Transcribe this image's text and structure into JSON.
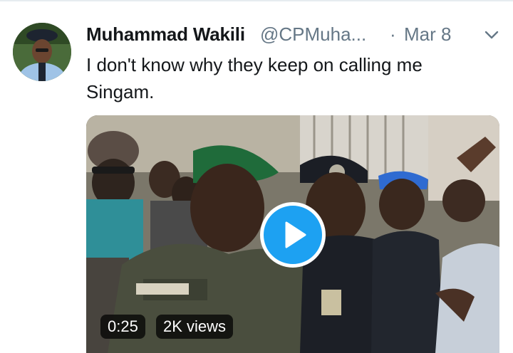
{
  "tweet": {
    "author_name": "Muhammad Wakili",
    "author_handle": "@CPMuha...",
    "separator": "·",
    "date": "Mar 8",
    "text": "I don't know why they keep on calling me Singam."
  },
  "video": {
    "duration": "0:25",
    "views": "2K views"
  },
  "icons": {
    "menu": "chevron-down-icon",
    "play": "play-icon"
  },
  "colors": {
    "accent": "#1da1f2",
    "secondary_text": "#657786",
    "primary_text": "#14171a"
  }
}
